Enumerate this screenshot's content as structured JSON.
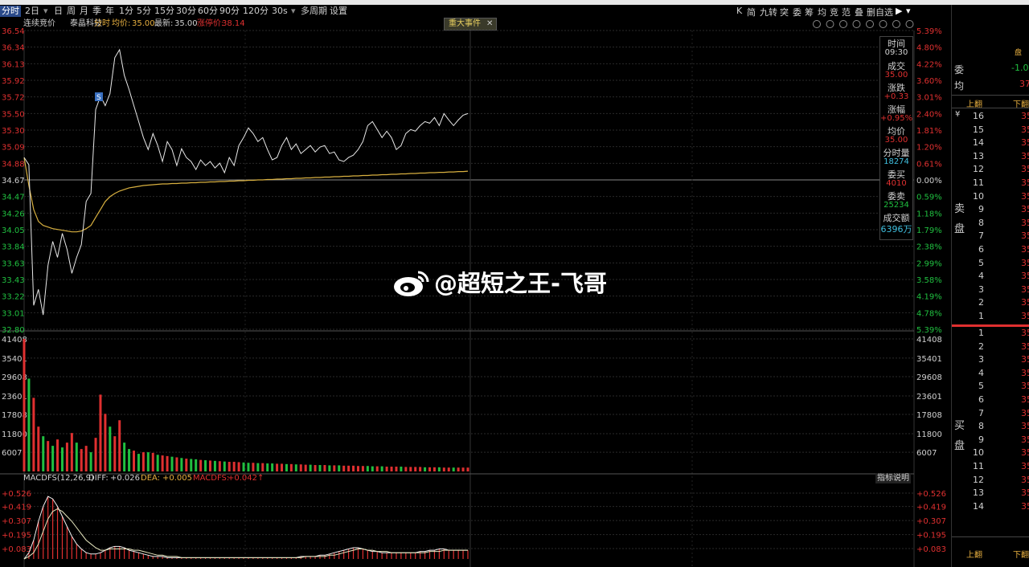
{
  "toolbar": {
    "periods": [
      "分时",
      "2日",
      "日",
      "周",
      "月",
      "季",
      "年",
      "1分",
      "5分",
      "15分",
      "30分",
      "60分",
      "90分",
      "120分",
      "30s",
      "多周期",
      "设置"
    ],
    "active_period": "分时",
    "right_tools": [
      "K",
      "简",
      "九转",
      "突",
      "委",
      "筹",
      "均",
      "竞",
      "范",
      "叠",
      "删自选"
    ]
  },
  "infobar": {
    "auction": "连续竞价",
    "stock_name": "泰晶科技",
    "mode": "分时",
    "avg_label": "均价:",
    "avg_value": "35.00",
    "latest_label": "最新:",
    "latest_value": "35.00",
    "limit_label": "涨停价:",
    "limit_value": "38.14",
    "event_tag": "重大事件"
  },
  "price_axis": {
    "left": [
      "36.54",
      "36.34",
      "36.13",
      "35.92",
      "35.72",
      "35.50",
      "35.30",
      "35.09",
      "34.88",
      "34.67",
      "34.47",
      "34.26",
      "34.05",
      "33.84",
      "33.63",
      "33.43",
      "33.22",
      "33.01",
      "32.80"
    ],
    "right": [
      "5.39%",
      "4.80%",
      "4.22%",
      "3.60%",
      "3.01%",
      "2.40%",
      "1.81%",
      "1.20%",
      "0.61%",
      "0.00%",
      "0.59%",
      "1.18%",
      "1.79%",
      "2.38%",
      "2.99%",
      "3.58%",
      "4.19%",
      "4.78%",
      "5.39%"
    ],
    "prev_close": "34.67"
  },
  "volume_axis": [
    "41408",
    "35401",
    "29608",
    "23601",
    "17808",
    "11800",
    "6007"
  ],
  "macd": {
    "title": "MACDFS(12,26,9)",
    "diff_label": "DIFF:",
    "diff_value": "+0.026",
    "dea_label": "DEA:",
    "dea_value": "+0.005",
    "macdfs_label": "MACDFS:",
    "macdfs_value": "+0.042↑",
    "axis": [
      "+0.526",
      "+0.419",
      "+0.307",
      "+0.195",
      "+0.083"
    ],
    "help_label": "指标说明"
  },
  "info_panel": {
    "time_label": "时间",
    "time_value": "09:30",
    "deal_label": "成交",
    "deal_value": "35.00",
    "change_label": "涨跌",
    "change_value": "+0.33",
    "pct_label": "涨幅",
    "pct_value": "+0.95%",
    "avg_label": "均价",
    "avg_value": "35.00",
    "minute_vol_label": "分时量",
    "minute_vol_value": "18274",
    "buy_order_label": "委买",
    "buy_order_value": "4010",
    "sell_order_label": "委卖",
    "sell_order_value": "25234",
    "turnover_label": "成交额",
    "turnover_value": "6396万"
  },
  "order_book": {
    "wei_label": "委",
    "jun_label": "均",
    "wei_value": "-1.0",
    "jun_value": "37",
    "top_right_label": "盘",
    "shang_fan": "上翻",
    "xia_fan": "下翻",
    "sell_side_label": [
      "卖",
      "盘"
    ],
    "buy_side_label": [
      "买",
      "盘"
    ],
    "sell_levels": [
      "16",
      "15",
      "14",
      "13",
      "12",
      "11",
      "10",
      "9",
      "8",
      "7",
      "6",
      "5",
      "4",
      "3",
      "2",
      "1"
    ],
    "buy_levels": [
      "1",
      "2",
      "3",
      "4",
      "5",
      "6",
      "7",
      "8",
      "9",
      "10",
      "11",
      "12",
      "13",
      "14"
    ],
    "price_stub": "35"
  },
  "watermark": "@超短之王-飞哥",
  "colors": {
    "up": "#e03030",
    "down": "#20c040",
    "price_line": "#e8e8e8",
    "avg_line": "#d8b040",
    "accent": "#2a4a8a"
  },
  "chart_data": {
    "type": "line",
    "series": [
      {
        "values": [
          34.95,
          34.86,
          33.1,
          33.3,
          32.98,
          33.6,
          33.9,
          33.7,
          34.0,
          33.8,
          33.5,
          33.7,
          33.86,
          34.4,
          34.5,
          35.55,
          35.72,
          35.6,
          35.75,
          36.2,
          36.3,
          35.98,
          35.8,
          35.6,
          35.4,
          35.2,
          35.05,
          35.25,
          35.1,
          34.9,
          35.15,
          35.05,
          34.85,
          35.06,
          34.95,
          34.9,
          34.8,
          34.92,
          34.85,
          34.9,
          34.82,
          34.88,
          34.76,
          34.95,
          34.85,
          35.1,
          35.2,
          35.32,
          35.25,
          35.15,
          35.2,
          35.05,
          34.92,
          34.95,
          35.1,
          35.2,
          35.05,
          35.12,
          35.0,
          35.05,
          35.1,
          35.02,
          35.08,
          35.1,
          35.0,
          35.02,
          34.92,
          34.9,
          34.95,
          34.98,
          35.05,
          35.15,
          35.35,
          35.4,
          35.3,
          35.2,
          35.28,
          35.2,
          35.05,
          35.1,
          35.25,
          35.3,
          35.28,
          35.35,
          35.4,
          35.38,
          35.45,
          35.35,
          35.5,
          35.42,
          35.35,
          35.42,
          35.48,
          35.5
        ]
      },
      {
        "values": [
          34.95,
          34.6,
          34.3,
          34.15,
          34.1,
          34.08,
          34.06,
          34.05,
          34.04,
          34.03,
          34.02,
          34.02,
          34.03,
          34.06,
          34.1,
          34.2,
          34.3,
          34.4,
          34.46,
          34.5,
          34.53,
          34.55,
          34.57,
          34.58,
          34.59,
          34.6,
          34.605,
          34.61,
          34.615,
          34.62,
          34.62,
          34.625,
          34.625,
          34.63,
          34.63,
          34.635,
          34.635,
          34.64,
          34.64,
          34.645,
          34.645,
          34.65,
          34.65,
          34.655,
          34.655,
          34.66,
          34.66,
          34.665,
          34.665,
          34.67,
          34.67,
          34.675,
          34.675,
          34.68,
          34.68,
          34.685,
          34.685,
          34.69,
          34.69,
          34.695,
          34.695,
          34.7,
          34.7,
          34.705,
          34.705,
          34.71,
          34.71,
          34.715,
          34.715,
          34.72,
          34.72,
          34.725,
          34.725,
          34.73,
          34.73,
          34.735,
          34.735,
          34.74,
          34.74,
          34.745,
          34.745,
          34.75,
          34.75,
          34.755,
          34.755,
          34.76,
          34.76,
          34.765,
          34.765,
          34.77,
          34.77,
          34.775,
          34.775,
          34.78
        ]
      }
    ],
    "volume": [
      41408,
      29000,
      23000,
      14000,
      11000,
      9500,
      8000,
      10000,
      7500,
      9000,
      12000,
      9000,
      7000,
      8000,
      6000,
      10500,
      24000,
      18000,
      14000,
      11000,
      16000,
      9000,
      7000,
      6500,
      5500,
      6000,
      6000,
      5800,
      5200,
      5000,
      4800,
      4600,
      4400,
      4200,
      4000,
      3900,
      3800,
      3600,
      3500,
      3400,
      3300,
      3200,
      3100,
      3000,
      3000,
      2900,
      2800,
      2700,
      2700,
      2600,
      2600,
      2500,
      2500,
      2400,
      2400,
      2300,
      2300,
      2200,
      2200,
      2100,
      2100,
      2000,
      2000,
      2000,
      1900,
      1900,
      1900,
      1800,
      1800,
      1800,
      1700,
      1700,
      1700,
      1600,
      1600,
      1600,
      1500,
      1500,
      1500,
      1500,
      1400,
      1400,
      1400,
      1400,
      1300,
      1300,
      1300,
      1300,
      1200,
      1200,
      1200,
      1200,
      1200,
      1200
    ],
    "volume_up": [
      1,
      0,
      1,
      1,
      0,
      1,
      0,
      1,
      0,
      1,
      1,
      0,
      1,
      1,
      0,
      1,
      1,
      1,
      0,
      1,
      1,
      0,
      0,
      1,
      0,
      1,
      0,
      1,
      0,
      1,
      1,
      0,
      1,
      0,
      1,
      0,
      0,
      1,
      0,
      1,
      0,
      1,
      0,
      1,
      1,
      1,
      0,
      0,
      1,
      0,
      1,
      0,
      0,
      1,
      1,
      0,
      1,
      0,
      1,
      1,
      0,
      1,
      0,
      1,
      0,
      1,
      0,
      1,
      1,
      1,
      1,
      1,
      0,
      0,
      1,
      0,
      1,
      1,
      1,
      0,
      1,
      1,
      1,
      1,
      0,
      1,
      1,
      0,
      1,
      1,
      0,
      1,
      1,
      1
    ],
    "diff": [
      0.0,
      0.05,
      0.15,
      0.3,
      0.42,
      0.5,
      0.48,
      0.42,
      0.34,
      0.26,
      0.18,
      0.12,
      0.08,
      0.05,
      0.04,
      0.04,
      0.05,
      0.07,
      0.09,
      0.1,
      0.1,
      0.09,
      0.07,
      0.06,
      0.05,
      0.04,
      0.03,
      0.02,
      0.02,
      0.02,
      0.01,
      0.01,
      0.01,
      0.01,
      0.01,
      0.01,
      0.01,
      0.01,
      0.01,
      0.01,
      0.01,
      0.01,
      0.01,
      0.01,
      0.01,
      0.01,
      0.01,
      0.01,
      0.01,
      0.01,
      0.01,
      0.01,
      0.01,
      0.01,
      0.01,
      0.01,
      0.01,
      0.01,
      0.02,
      0.02,
      0.02,
      0.02,
      0.03,
      0.03,
      0.04,
      0.05,
      0.06,
      0.07,
      0.08,
      0.09,
      0.09,
      0.08,
      0.07,
      0.06,
      0.06,
      0.05,
      0.05,
      0.05,
      0.05,
      0.05,
      0.05,
      0.05,
      0.05,
      0.06,
      0.06,
      0.07,
      0.07,
      0.08,
      0.08,
      0.07,
      0.07,
      0.07,
      0.07,
      0.07
    ],
    "dea": [
      0.0,
      0.02,
      0.05,
      0.12,
      0.22,
      0.32,
      0.38,
      0.4,
      0.38,
      0.34,
      0.3,
      0.25,
      0.2,
      0.15,
      0.12,
      0.09,
      0.07,
      0.07,
      0.08,
      0.08,
      0.08,
      0.08,
      0.08,
      0.07,
      0.07,
      0.06,
      0.05,
      0.04,
      0.03,
      0.03,
      0.02,
      0.02,
      0.02,
      0.01,
      0.01,
      0.01,
      0.01,
      0.01,
      0.01,
      0.01,
      0.01,
      0.01,
      0.01,
      0.01,
      0.01,
      0.01,
      0.01,
      0.01,
      0.01,
      0.01,
      0.01,
      0.01,
      0.01,
      0.01,
      0.01,
      0.01,
      0.01,
      0.01,
      0.01,
      0.02,
      0.02,
      0.02,
      0.02,
      0.02,
      0.03,
      0.03,
      0.04,
      0.05,
      0.06,
      0.07,
      0.08,
      0.08,
      0.07,
      0.07,
      0.06,
      0.06,
      0.06,
      0.05,
      0.05,
      0.05,
      0.05,
      0.05,
      0.05,
      0.05,
      0.05,
      0.06,
      0.06,
      0.06,
      0.07,
      0.07,
      0.07,
      0.07,
      0.07,
      0.07
    ]
  }
}
